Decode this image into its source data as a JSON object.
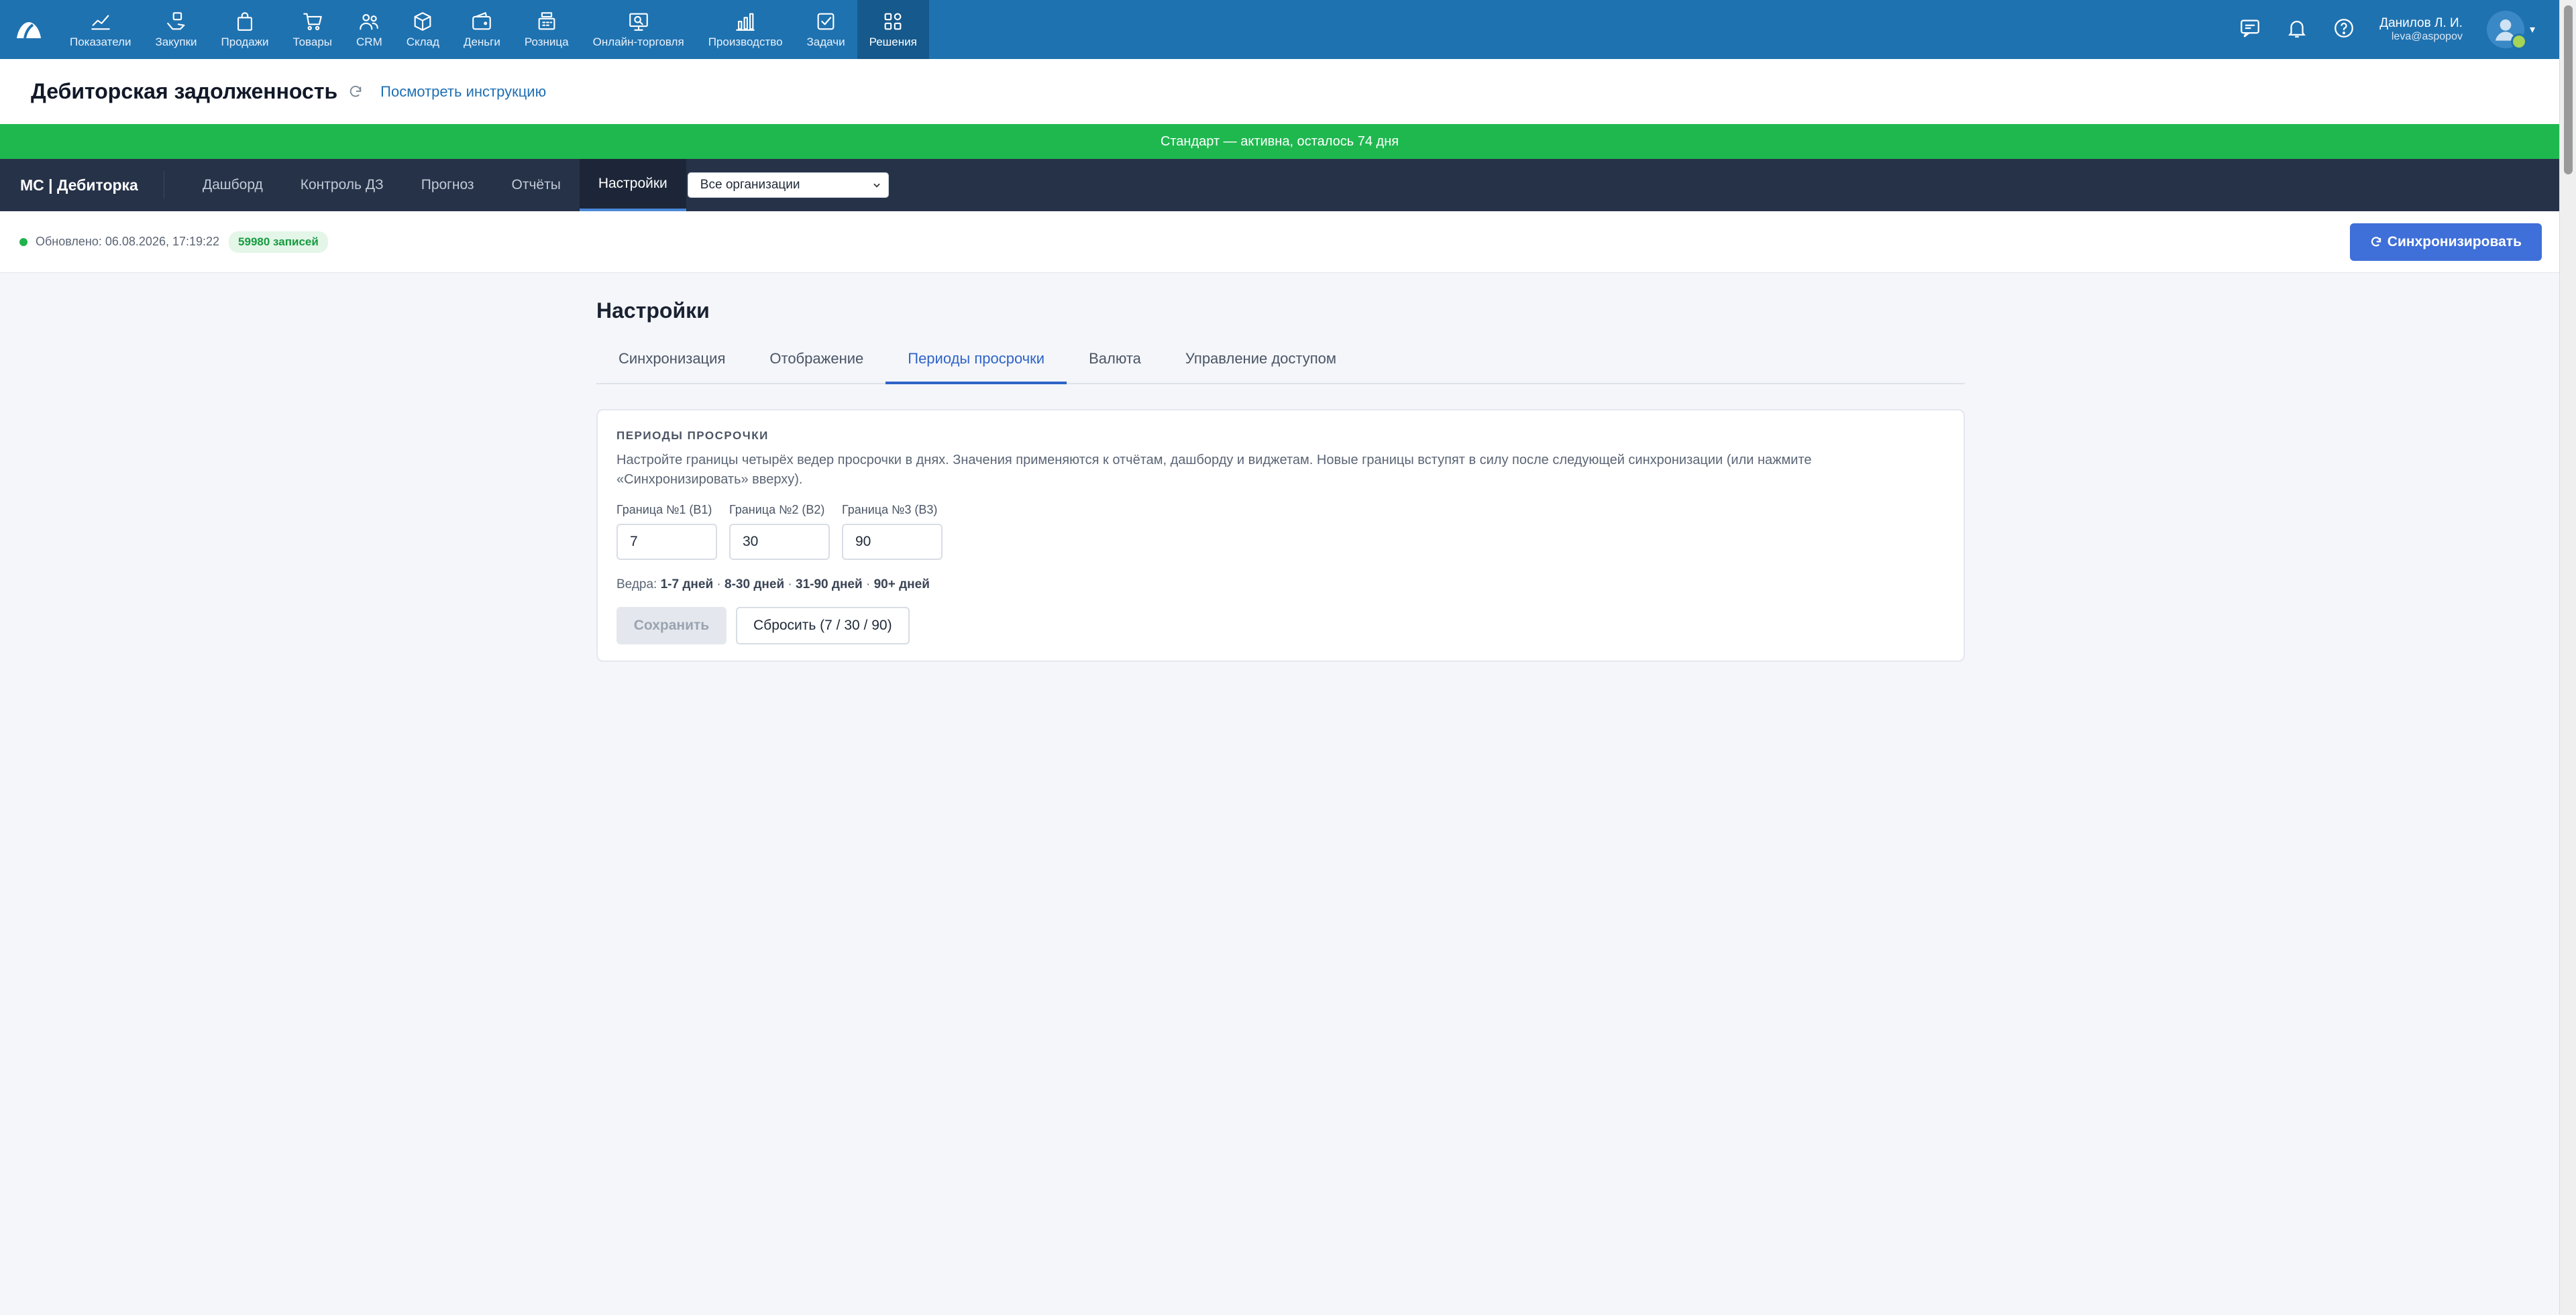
{
  "topnav": {
    "items": [
      {
        "label": "Показатели",
        "icon": "chart-line-icon"
      },
      {
        "label": "Закупки",
        "icon": "hand-package-icon"
      },
      {
        "label": "Продажи",
        "icon": "shopping-bag-icon"
      },
      {
        "label": "Товары",
        "icon": "cart-icon"
      },
      {
        "label": "CRM",
        "icon": "users-icon"
      },
      {
        "label": "Склад",
        "icon": "box-icon"
      },
      {
        "label": "Деньги",
        "icon": "wallet-icon"
      },
      {
        "label": "Розница",
        "icon": "cash-register-icon"
      },
      {
        "label": "Онлайн-торговля",
        "icon": "online-store-icon"
      },
      {
        "label": "Производство",
        "icon": "bar-chart-icon"
      },
      {
        "label": "Задачи",
        "icon": "checkbox-icon"
      },
      {
        "label": "Решения",
        "icon": "apps-grid-icon"
      }
    ],
    "active_index": 11,
    "user": {
      "name": "Данилов Л. И.",
      "email": "leva@aspopov"
    }
  },
  "page": {
    "title": "Дебиторская задолженность",
    "instruction_link": "Посмотреть инструкцию"
  },
  "banner": {
    "text": "Стандарт — активна, осталось 74 дня"
  },
  "appnav": {
    "brand": "МС | Дебиторка",
    "tabs": [
      "Дашборд",
      "Контроль ДЗ",
      "Прогноз",
      "Отчёты",
      "Настройки"
    ],
    "active_tab": 4,
    "org_select": "Все организации"
  },
  "status": {
    "updated": "Обновлено: 06.08.2026, 17:19:22",
    "records_badge": "59980 записей",
    "sync_button": "Синхронизировать"
  },
  "settings": {
    "title": "Настройки",
    "tabs": [
      "Синхронизация",
      "Отображение",
      "Периоды просрочки",
      "Валюта",
      "Управление доступом"
    ],
    "active_tab": 2,
    "card": {
      "title": "ПЕРИОДЫ ПРОСРОЧКИ",
      "description": "Настройте границы четырёх ведер просрочки в днях. Значения применяются к отчётам, дашборду и виджетам. Новые границы вступят в силу после следующей синхронизации (или нажмите «Синхронизировать» вверху).",
      "fields": [
        {
          "label": "Граница №1 (B1)",
          "value": "7"
        },
        {
          "label": "Граница №2 (B2)",
          "value": "30"
        },
        {
          "label": "Граница №3 (B3)",
          "value": "90"
        }
      ],
      "buckets_label": "Ведра:",
      "buckets": [
        "1-7 дней",
        "8-30 дней",
        "31-90 дней",
        "90+ дней"
      ],
      "buckets_sep": " · ",
      "save_button": "Сохранить",
      "reset_button": "Сбросить (7 / 30 / 90)"
    }
  },
  "colors": {
    "topnav": "#1f72b0",
    "banner": "#1fb84f",
    "appnav": "#263248",
    "accent": "#3f6fd8"
  }
}
